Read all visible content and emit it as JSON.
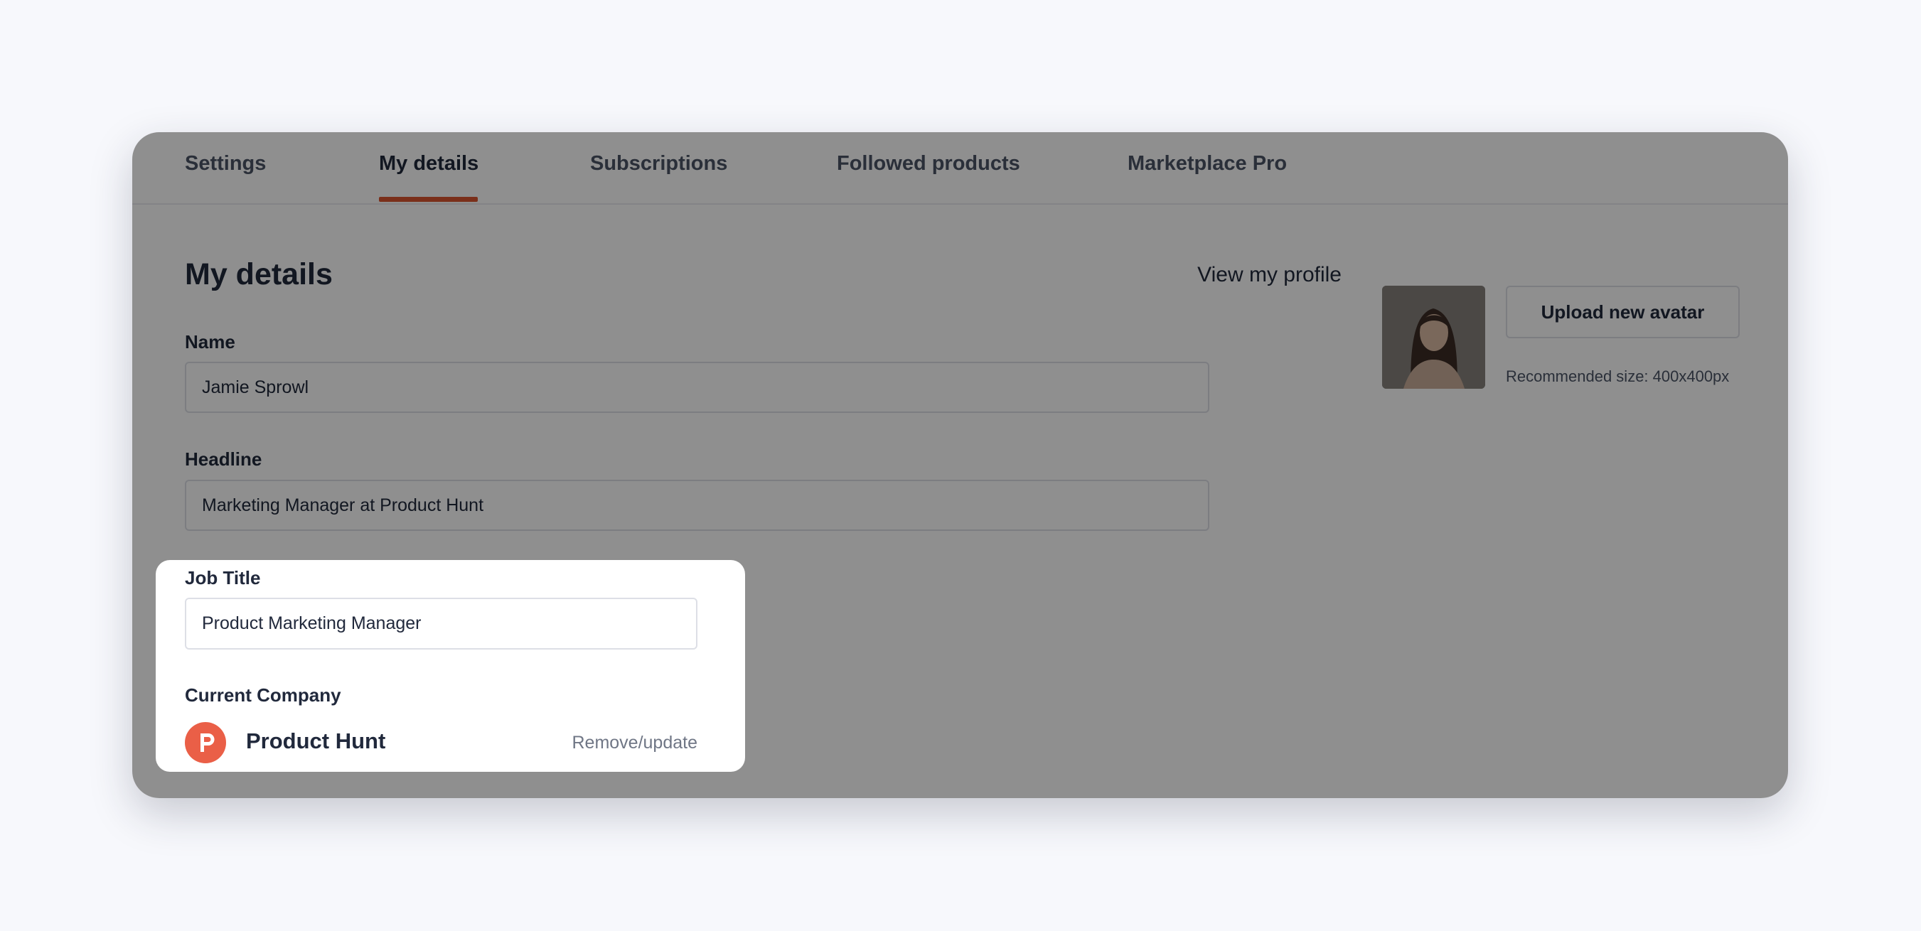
{
  "tabs": [
    {
      "label": "Settings",
      "active": false
    },
    {
      "label": "My details",
      "active": true
    },
    {
      "label": "Subscriptions",
      "active": false
    },
    {
      "label": "Followed products",
      "active": false
    },
    {
      "label": "Marketplace Pro",
      "active": false
    }
  ],
  "page": {
    "title": "My details",
    "view_profile_link": "View my profile"
  },
  "form": {
    "name": {
      "label": "Name",
      "value": "Jamie Sprowl"
    },
    "headline": {
      "label": "Headline",
      "value": "Marketing Manager at Product Hunt"
    },
    "job_title": {
      "label": "Job Title",
      "value": "Product Marketing Manager"
    },
    "company": {
      "label": "Current Company",
      "name": "Product Hunt",
      "logo_letter": "P",
      "action_label": "Remove/update"
    }
  },
  "avatar": {
    "upload_label": "Upload new avatar",
    "hint": "Recommended size: 400x400px"
  },
  "colors": {
    "accent": "#da552f",
    "logo": "#ea5f47",
    "overlay": "rgba(0,0,0,0.44)"
  }
}
